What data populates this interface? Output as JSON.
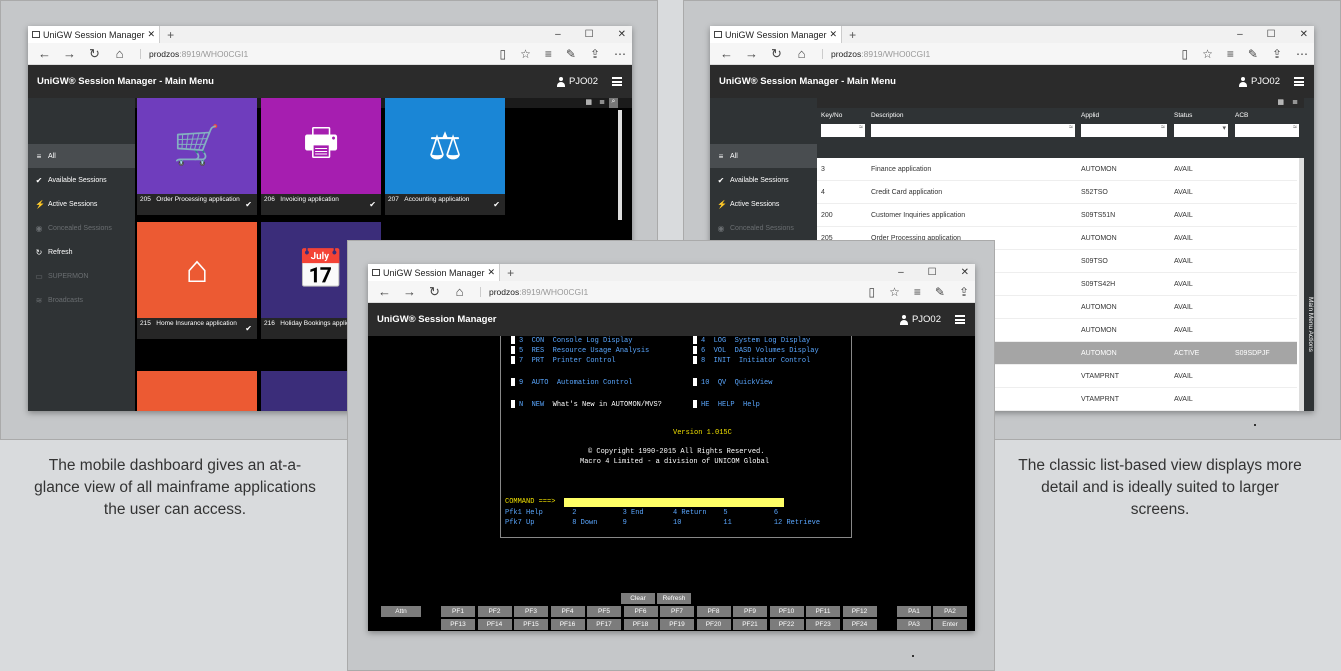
{
  "left_window": {
    "tab_title": "UniGW Session Manager",
    "url_host": "prodzos",
    "url_path": ":8919/WHO0CGI1",
    "app_title": "UniGW® Session Manager - Main Menu",
    "user": "PJO02",
    "sidebar": [
      {
        "icon": "≡",
        "label": "All"
      },
      {
        "icon": "✔",
        "label": "Available Sessions"
      },
      {
        "icon": "⚡",
        "label": "Active Sessions"
      },
      {
        "icon": "◉",
        "label": "Concealed Sessions"
      },
      {
        "icon": "↻",
        "label": "Refresh"
      },
      {
        "icon": "▭",
        "label": "SUPERMON"
      },
      {
        "icon": "≋",
        "label": "Broadcasts"
      }
    ],
    "tiles": [
      {
        "num": "205",
        "label": "Order Processing application",
        "color": "#6f3dbd",
        "icon": "cart-icon"
      },
      {
        "num": "206",
        "label": "Invoicing application",
        "color": "#a61eb0",
        "icon": "printer-icon"
      },
      {
        "num": "207",
        "label": "Accounting application",
        "color": "#1a86d6",
        "icon": "scales-icon"
      },
      {
        "num": "215",
        "label": "Home Insurance application",
        "color": "#ec5a33",
        "icon": "home-icon"
      },
      {
        "num": "216",
        "label": "Holiday Bookings application",
        "color": "#3b2d7a",
        "icon": "calendar-icon"
      }
    ]
  },
  "right_window": {
    "tab_title": "UniGW Session Manager",
    "url_host": "prodzos",
    "url_path": ":8919/WHO0CGI1",
    "app_title": "UniGW® Session Manager - Main Menu",
    "user": "PJO02",
    "side_tab": "Main Menu Actions",
    "sidebar": [
      {
        "icon": "≡",
        "label": "All"
      },
      {
        "icon": "✔",
        "label": "Available Sessions"
      },
      {
        "icon": "⚡",
        "label": "Active Sessions"
      },
      {
        "icon": "◉",
        "label": "Concealed Sessions"
      }
    ],
    "columns": [
      "Key/No",
      "Description",
      "Applid",
      "Status",
      "ACB"
    ],
    "rows": [
      [
        "3",
        "Finance application",
        "AUTOMON",
        "AVAIL",
        ""
      ],
      [
        "4",
        "Credit Card application",
        "S52TSO",
        "AVAIL",
        ""
      ],
      [
        "200",
        "Customer Inquiries application",
        "S09TS51N",
        "AVAIL",
        ""
      ],
      [
        "205",
        "Order Processing application",
        "AUTOMON",
        "AVAIL",
        ""
      ],
      [
        "",
        "",
        "S09TSO",
        "AVAIL",
        ""
      ],
      [
        "",
        "",
        "S09TS42H",
        "AVAIL",
        ""
      ],
      [
        "",
        "",
        "AUTOMON",
        "AVAIL",
        ""
      ],
      [
        "",
        "",
        "AUTOMON",
        "AVAIL",
        ""
      ],
      [
        "",
        "",
        "AUTOMON",
        "ACTIVE",
        "S09SDPJF"
      ],
      [
        "",
        "",
        "VTAMPRNT",
        "AVAIL",
        ""
      ],
      [
        "",
        "",
        "VTAMPRNT",
        "AVAIL",
        ""
      ]
    ]
  },
  "center_window": {
    "tab_title": "UniGW Session Manager",
    "url_host": "prodzos",
    "url_path": ":8919/WHO0CGI1",
    "app_title": "UniGW® Session Manager",
    "user": "PJO02",
    "menu": [
      [
        "3",
        "CON",
        "Console Log Display",
        "4",
        "LOG",
        "System Log Display"
      ],
      [
        "5",
        "RES",
        "Resource Usage Analysis",
        "6",
        "VOL",
        "DASD Volumes Display"
      ],
      [
        "7",
        "PRT",
        "Printer Control",
        "8",
        "INIT",
        "Initiator Control"
      ]
    ],
    "auto": [
      "9",
      "AUTO",
      "Automation Control",
      "10",
      "QV",
      "QuickView"
    ],
    "new": [
      "N",
      "NEW",
      "What's New in AUTOMON/MVS?",
      "HE",
      "HELP",
      "Help"
    ],
    "version": "Version 1.015C",
    "copyright1": "© Copyright 1990-2015 All Rights Reserved.",
    "copyright2": "Macro 4 Limited - a division of UNICOM Global",
    "command": "COMMAND ===>",
    "pfk1": "Pfk1 Help       2           3 End       4 Return    5           6",
    "pfk2": "Pfk7 Up         8 Down      9           10          11          12 Retrieve",
    "keys_top": [
      "Clear",
      "Refresh"
    ],
    "attn": "Attn",
    "pf_row1": [
      "PF1",
      "PF2",
      "PF3",
      "PF4",
      "PF5",
      "PF6",
      "PF7",
      "PF8",
      "PF9",
      "PF10",
      "PF11",
      "PF12"
    ],
    "pf_row2": [
      "PF13",
      "PF14",
      "PF15",
      "PF16",
      "PF17",
      "PF18",
      "PF19",
      "PF20",
      "PF21",
      "PF22",
      "PF23",
      "PF24"
    ],
    "pa_row1": [
      "PA1",
      "PA2"
    ],
    "pa_row2": [
      "PA3",
      "Enter"
    ]
  },
  "captions": {
    "left": "The mobile dashboard gives an at-a-glance view of all mainframe applications the user can access.",
    "right": "The classic list-based view displays more detail and is ideally suited to larger screens."
  },
  "colors": {
    "terminal_bg": "#000000",
    "terminal_text": "#ffffff",
    "terminal_blue": "#5aa7ff",
    "version_yellow": "#f0e000",
    "command_bar": "#ffff66"
  }
}
